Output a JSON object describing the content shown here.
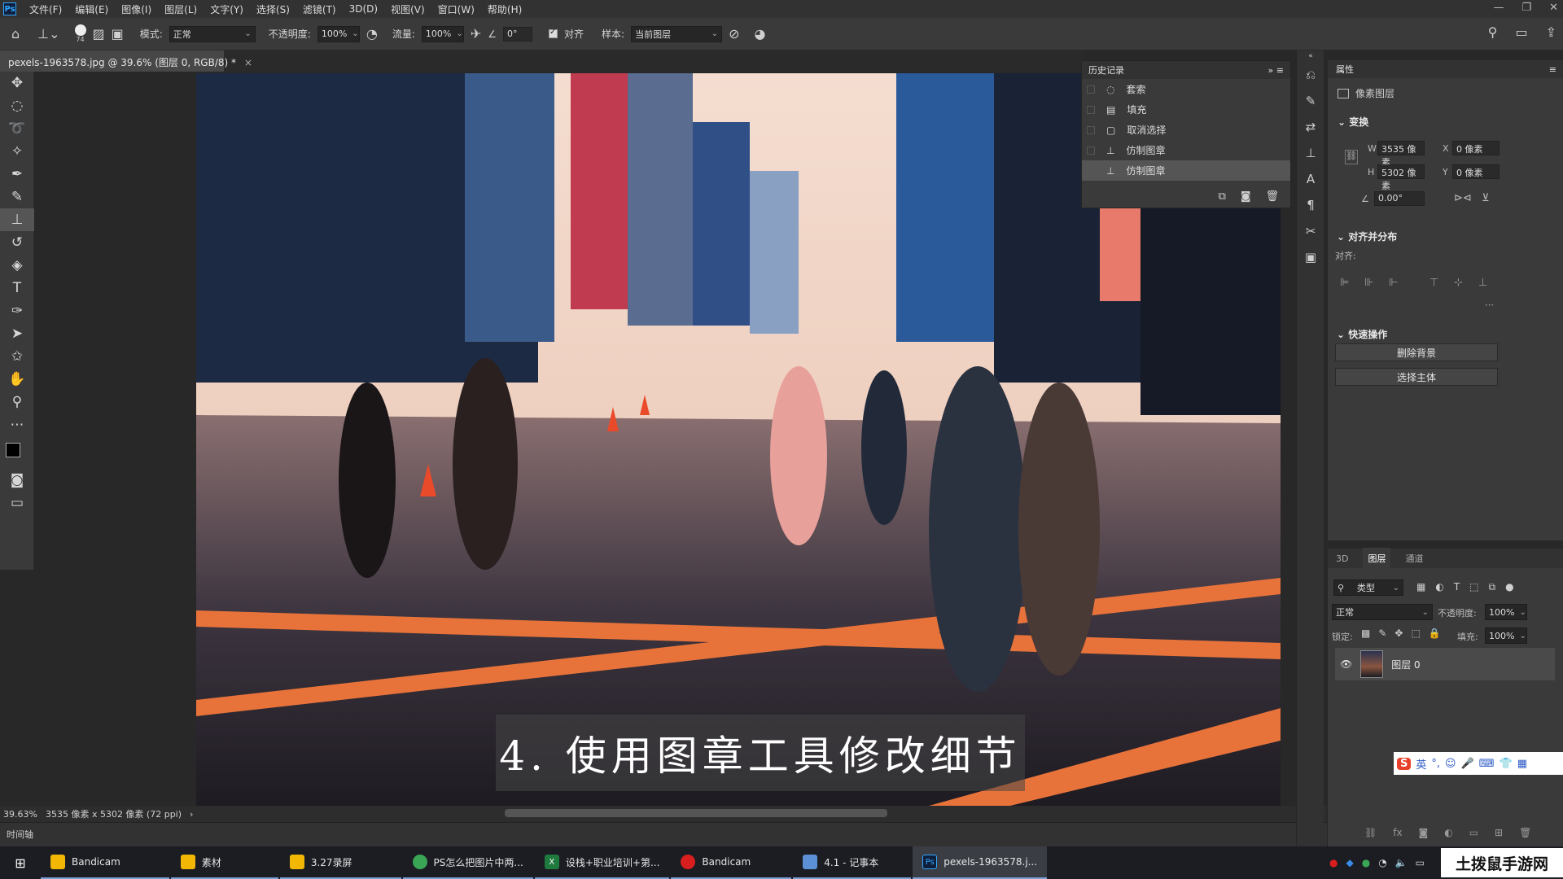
{
  "menu": {
    "logo": "Ps",
    "items": [
      "文件(F)",
      "编辑(E)",
      "图像(I)",
      "图层(L)",
      "文字(Y)",
      "选择(S)",
      "滤镜(T)",
      "3D(D)",
      "视图(V)",
      "窗口(W)",
      "帮助(H)"
    ]
  },
  "options": {
    "brush_size": "74",
    "mode_label": "模式:",
    "mode_value": "正常",
    "opacity_label": "不透明度:",
    "opacity_value": "100%",
    "flow_label": "流量:",
    "flow_value": "100%",
    "angle_value": "0°",
    "aligned_label": "对齐",
    "sample_label": "样本:",
    "sample_value": "当前图层"
  },
  "document": {
    "tab_title": "pexels-1963578.jpg @ 39.6% (图层 0, RGB/8) *"
  },
  "caption": "4. 使用图章工具修改细节",
  "status": {
    "zoom": "39.63%",
    "doc_info": "3535 像素 x 5302 像素 (72 ppi)"
  },
  "timeline_label": "时间轴",
  "history": {
    "title": "历史记录",
    "items": [
      "套索",
      "填充",
      "取消选择",
      "仿制图章",
      "仿制图章"
    ]
  },
  "properties": {
    "title": "属性",
    "layer_kind": "像素图层",
    "transform_title": "变换",
    "w_label": "W",
    "w_value": "3535 像素",
    "h_label": "H",
    "h_value": "5302 像素",
    "x_label": "X",
    "x_value": "0 像素",
    "y_label": "Y",
    "y_value": "0 像素",
    "angle_value": "0.00°",
    "align_title": "对齐并分布",
    "align_label": "对齐:",
    "quick_title": "快速操作",
    "remove_bg": "删除背景",
    "select_subject": "选择主体"
  },
  "layers": {
    "tabs": [
      "3D",
      "图层",
      "通道"
    ],
    "filter_value": "类型",
    "blend_value": "正常",
    "opacity_label": "不透明度:",
    "opacity_value": "100%",
    "lock_label": "锁定:",
    "fill_label": "填充:",
    "fill_value": "100%",
    "layer_name": "图层 0"
  },
  "taskbar": {
    "items": [
      {
        "label": "Bandicam",
        "color": "#f2b705"
      },
      {
        "label": "素材",
        "color": "#f2b705"
      },
      {
        "label": "3.27录屏",
        "color": "#f2b705"
      },
      {
        "label": "PS怎么把图片中两...",
        "color": "#3aa655"
      },
      {
        "label": "设栈+职业培训+第...",
        "color": "#1f7a3e"
      },
      {
        "label": "Bandicam",
        "color": "#d81e1e"
      },
      {
        "label": "4.1 - 记事本",
        "color": "#5b8fd6"
      },
      {
        "label": "pexels-1963578.j...",
        "color": "#0f1e3a"
      }
    ]
  },
  "ime": {
    "brand": "S",
    "lang": "英"
  },
  "watermark": "土拨鼠手游网"
}
